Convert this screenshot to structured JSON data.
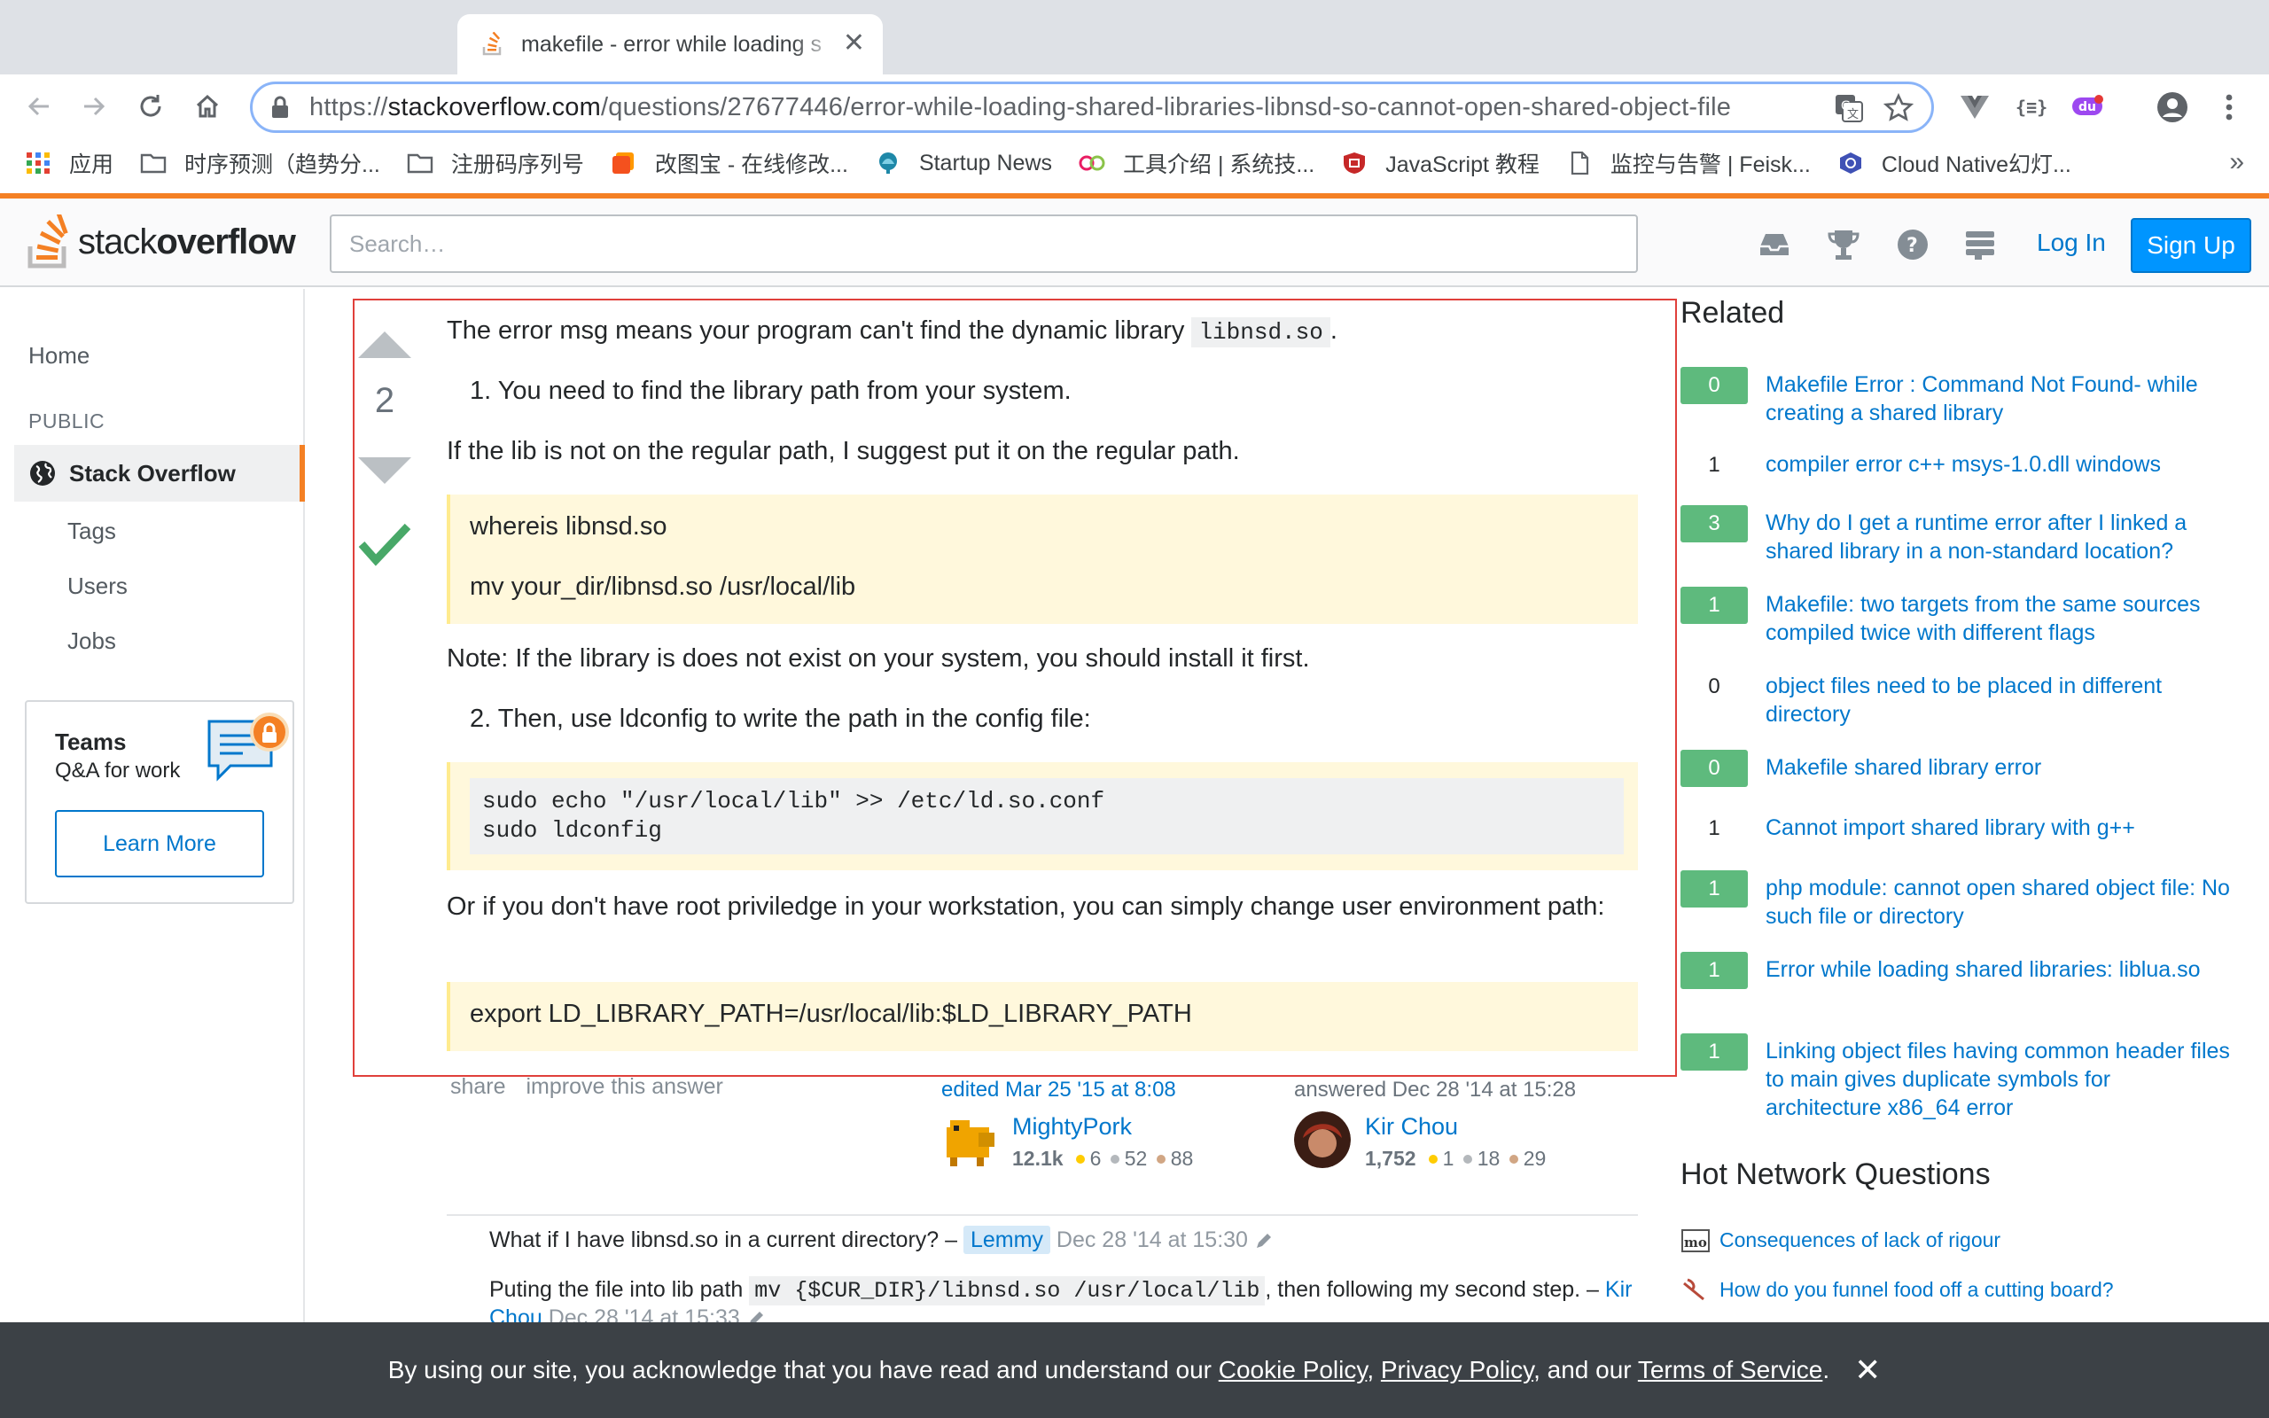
{
  "browser": {
    "tab_title": "makefile - error while loading s",
    "url_scheme": "https://",
    "url_host": "stackoverflow.com",
    "url_path": "/questions/27677446/error-while-loading-shared-libraries-libnsd-so-cannot-open-shared-object-file",
    "bookmarks": [
      {
        "label": "应用",
        "icon": "apps-grid-icon"
      },
      {
        "label": "时序预测（趋势分...",
        "icon": "folder-icon"
      },
      {
        "label": "注册码序列号",
        "icon": "folder-icon"
      },
      {
        "label": "改图宝 - 在线修改...",
        "icon": "gaitubao-icon"
      },
      {
        "label": "Startup News",
        "icon": "startup-news-icon"
      },
      {
        "label": "工具介绍 | 系统技...",
        "icon": "tools-icon"
      },
      {
        "label": "JavaScript 教程",
        "icon": "shield-icon"
      },
      {
        "label": "监控与告警 | Feisk...",
        "icon": "document-icon"
      },
      {
        "label": "Cloud Native幻灯...",
        "icon": "cloud-native-icon"
      }
    ],
    "bookmarks_overflow": "»"
  },
  "so_header": {
    "logo_plain": "stack",
    "logo_bold": "overflow",
    "search_placeholder": "Search…",
    "login_label": "Log In",
    "signup_label": "Sign Up"
  },
  "leftnav": {
    "home": "Home",
    "section": "PUBLIC",
    "active": "Stack Overflow",
    "tags": "Tags",
    "users": "Users",
    "jobs": "Jobs",
    "teams_title": "Teams",
    "teams_sub": "Q&A for work",
    "teams_button": "Learn More"
  },
  "answer": {
    "vote_count": "2",
    "intro_before": "The error msg means your program can't find the dynamic library",
    "intro_code": "libnsd.so",
    "intro_after": ".",
    "step1": "1. You need to find the library path from your system.",
    "regular_path": "If the lib is not on the regular path, I suggest put it on the regular path.",
    "quote1_line1": "whereis libnsd.so",
    "quote1_line2": "mv your_dir/libnsd.so /usr/local/lib",
    "note": "Note: If the library is does not exist on your system, you should install it first.",
    "step2": "2. Then, use ldconfig to write the path in the config file:",
    "code_block": "sudo echo \"/usr/local/lib\" >> /etc/ld.so.conf\nsudo ldconfig",
    "root_para": "Or if you don't have root priviledge in your workstation, you can simply change user environment path:",
    "quote2": "export LD_LIBRARY_PATH=/usr/local/lib:$LD_LIBRARY_PATH",
    "share": "share",
    "improve": "improve this answer",
    "edited_action": "edited Mar 25 '15 at 8:08",
    "editor_name": "MightyPork",
    "editor_rep": "12.1k",
    "editor_gold": "6",
    "editor_silver": "52",
    "editor_bronze": "88",
    "answered_action": "answered Dec 28 '14 at 15:28",
    "author_name": "Kir Chou",
    "author_rep": "1,752",
    "author_gold": "1",
    "author_silver": "18",
    "author_bronze": "29"
  },
  "comments": [
    {
      "text": "What if I have libnsd.so in a current directory? –",
      "user": "Lemmy",
      "date": "Dec 28 '14 at 15:30"
    },
    {
      "text_before": "Puting the file into lib path",
      "code": "mv {$CUR_DIR}/libnsd.so /usr/local/lib",
      "text_after": ", then following my second step. –",
      "user": "Kir Chou",
      "date": "Dec 28 '14 at 15:33"
    }
  ],
  "related": {
    "title": "Related",
    "items": [
      {
        "score": "0",
        "answered": true,
        "title": "Makefile Error : Command Not Found- while creating a shared library"
      },
      {
        "score": "1",
        "answered": false,
        "title": "compiler error c++ msys-1.0.dll windows"
      },
      {
        "score": "3",
        "answered": true,
        "title": "Why do I get a runtime error after I linked a shared library in a non-standard location?"
      },
      {
        "score": "1",
        "answered": true,
        "title": "Makefile: two targets from the same sources compiled twice with different flags"
      },
      {
        "score": "0",
        "answered": false,
        "title": "object files need to be placed in different directory"
      },
      {
        "score": "0",
        "answered": true,
        "title": "Makefile shared library error"
      },
      {
        "score": "1",
        "answered": false,
        "title": "Cannot import shared library with g++"
      },
      {
        "score": "1",
        "answered": true,
        "title": "php module: cannot open shared object file: No such file or directory"
      },
      {
        "score": "1",
        "answered": true,
        "title": "Error while loading shared libraries: liblua.so"
      },
      {
        "score": "1",
        "answered": true,
        "title": "Linking object files having common header files to main gives duplicate symbols for architecture x86_64 error"
      }
    ]
  },
  "hnq": {
    "title": "Hot Network Questions",
    "items": [
      {
        "title": "Consequences of lack of rigour",
        "site": "mathoverflow-icon"
      },
      {
        "title": "How do you funnel food off a cutting board?",
        "site": "cooking-icon"
      }
    ]
  },
  "cookie": {
    "before": "By using our site, you acknowledge that you have read and understand our ",
    "cookie_policy": "Cookie Policy",
    "sep1": ", ",
    "privacy_policy": "Privacy Policy",
    "sep2": ", and our ",
    "terms": "Terms of Service",
    "end": "."
  },
  "colors": {
    "so_orange": "#f48024",
    "link_blue": "#0077cc",
    "answered_green": "#5eba7d",
    "highlight_red": "#e0403b"
  }
}
